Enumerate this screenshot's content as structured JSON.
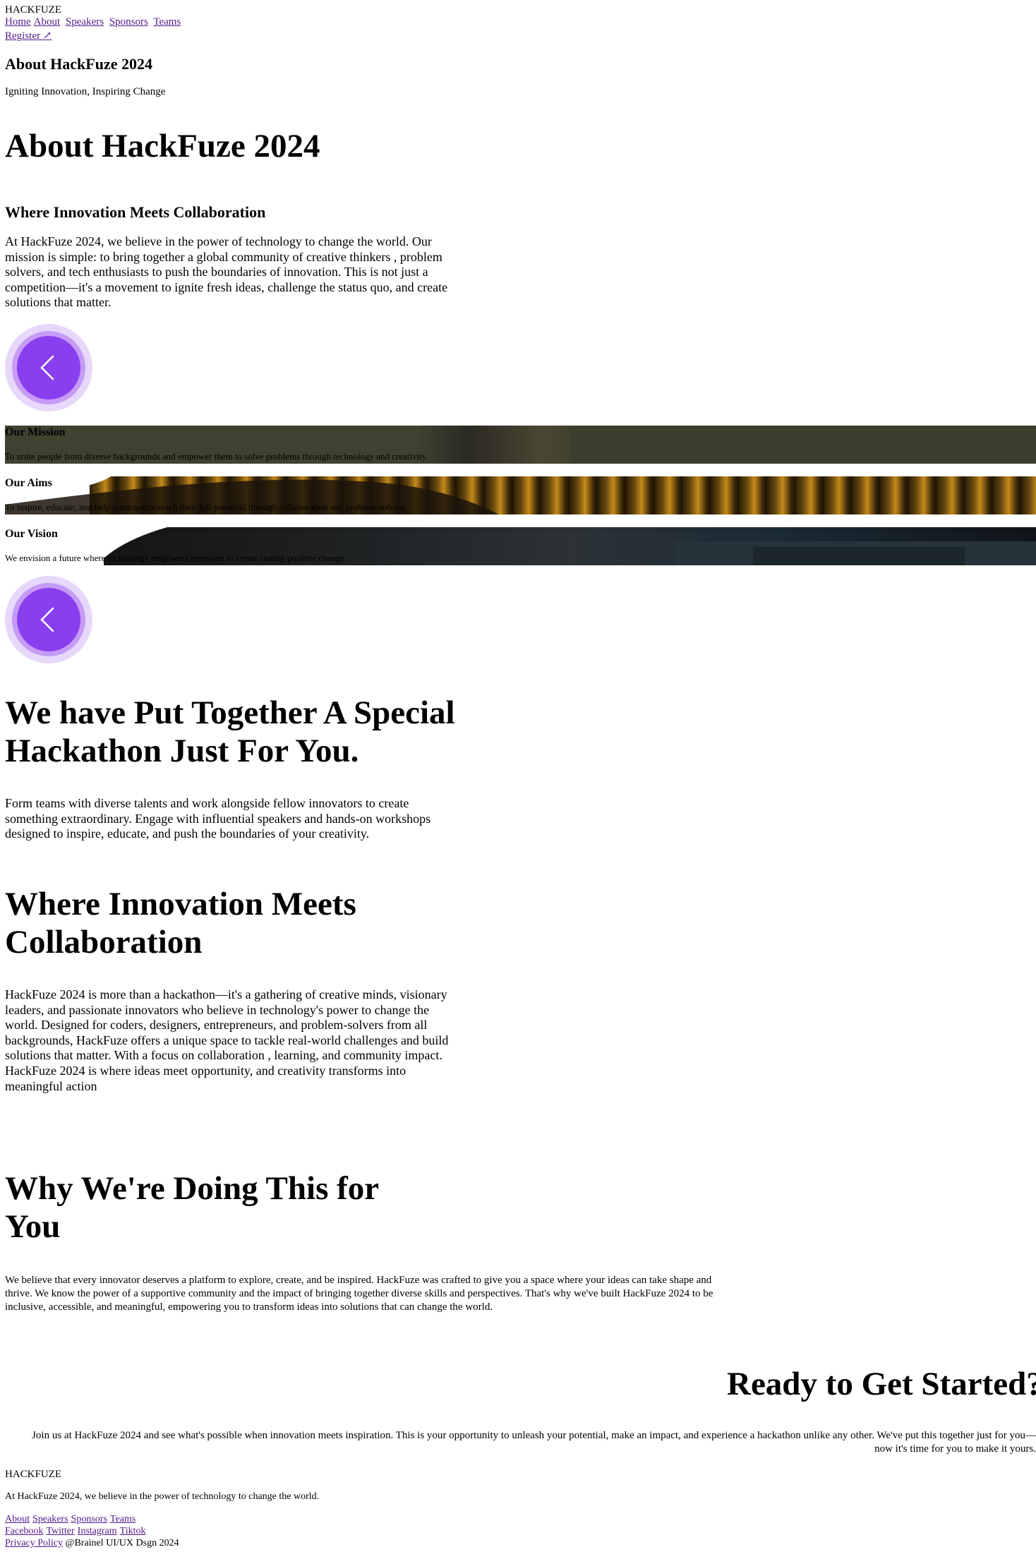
{
  "header": {
    "logo": "HACKFUZE",
    "nav": [
      "Home",
      "About",
      "Speakers",
      "Sponsors",
      "Teams"
    ],
    "register": "Register ↗"
  },
  "hero": {
    "title": "About HackFuze 2024",
    "tagline": "Igniting Innovation, Inspiring Change"
  },
  "about": {
    "title": "About HackFuze 2024",
    "subtitle": "Where Innovation Meets Collaboration",
    "text": "At HackFuze 2024, we believe in the power of technology to change the world. Our mission is simple: to bring together a global community of creative thinkers , problem solvers, and tech enthusiasts to push the boundaries of innovation. This is not just a competition—it's a movement to ignite fresh ideas, challenge the status quo, and create solutions that matter."
  },
  "strips": [
    {
      "heading": "Our Mission",
      "text": "To unite people from diverse backgrounds and empower them to solve problems through technology and creativity."
    },
    {
      "heading": "Our Aims",
      "text": "To inspire, educate, and help participants reach their full potential through collaboration and problem-solving"
    },
    {
      "heading": "Our Vision",
      "text": "We envision a future where technology empowers everyone to create lasting positive change."
    }
  ],
  "special": {
    "title": "We have Put Together A Special Hackathon Just For You.",
    "text": "Form teams with diverse talents and work alongside fellow innovators to create something extraordinary. Engage with influential speakers and hands-on workshops designed to inspire, educate, and push the boundaries of your creativity."
  },
  "innovation": {
    "title": "Where Innovation Meets Collaboration",
    "text": "HackFuze 2024 is more than a hackathon—it's a gathering of creative minds, visionary leaders, and passionate innovators who believe in technology's power to change the world. Designed for coders, designers, entrepreneurs, and problem-solvers from all backgrounds, HackFuze offers a unique space to tackle real-world challenges and build solutions that matter. With a focus on collaboration , learning, and community impact. HackFuze 2024 is where ideas meet opportunity, and creativity transforms into meaningful action"
  },
  "why": {
    "title": "Why We're Doing This for You",
    "text": "We believe that every innovator deserves a platform to explore, create, and be inspired. HackFuze was crafted to give you a space where your ideas can take shape and thrive. We know the power of a supportive community and the impact of bringing together diverse skills and perspectives. That's why we've built HackFuze 2024 to be inclusive, accessible, and meaningful, empowering you to transform ideas into solutions that can change the world."
  },
  "ready": {
    "title": "Ready to Get Started?",
    "text": "Join us at HackFuze 2024 and see what's possible when innovation meets inspiration. This is your opportunity to unleash your potential, make an impact, and experience a hackathon unlike any other. We've put this together just for you—now it's time for you to make it yours."
  },
  "footer": {
    "logo": "HACKFUZE",
    "tagline": "At HackFuze 2024, we believe in the power of technology to change the world.",
    "links": [
      "About",
      "Speakers",
      "Sponsors",
      "Teams"
    ],
    "social": [
      "Facebook",
      "Twitter",
      "Instagram",
      "Tiktok"
    ],
    "privacy": "Privacy Policy",
    "credit": "@Brainel UI/UX Dsgn 2024"
  },
  "colors": {
    "link": "#551a8b",
    "button_outer": "#e7d8fb",
    "button_mid": "#c69bf6",
    "button_core": "#8a3fee"
  },
  "icons": {
    "prev_button": "chevron-left-icon"
  }
}
